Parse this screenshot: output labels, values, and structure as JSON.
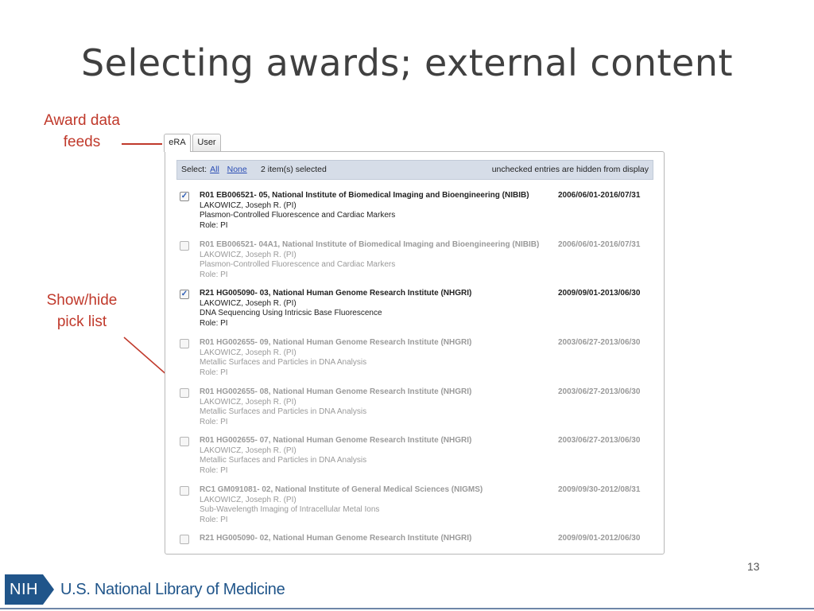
{
  "slide": {
    "title": "Selecting awards; external content",
    "page_number": "13"
  },
  "callouts": [
    {
      "line1": "Award data",
      "line2": "feeds"
    },
    {
      "line1": "Show/hide",
      "line2": "pick list"
    }
  ],
  "tabs": [
    {
      "label": "eRA",
      "active": true
    },
    {
      "label": "User",
      "active": false
    }
  ],
  "toolbar": {
    "select_label": "Select:",
    "all_link": "All",
    "none_link": "None",
    "count_text": "2 item(s) selected",
    "hidden_note": "unchecked entries are hidden from display"
  },
  "entries": [
    {
      "checked": true,
      "title": "R01 EB006521- 05, National Institute of Biomedical Imaging and Bioengineering (NIBIB)",
      "dates": "2006/06/01-2016/07/31",
      "person": "LAKOWICZ, Joseph R. (PI)",
      "project": "Plasmon-Controlled Fluorescence and Cardiac Markers",
      "role": "Role: PI"
    },
    {
      "checked": false,
      "title": "R01 EB006521- 04A1, National Institute of Biomedical Imaging and Bioengineering (NIBIB)",
      "dates": "2006/06/01-2016/07/31",
      "person": "LAKOWICZ, Joseph R. (PI)",
      "project": "Plasmon-Controlled Fluorescence and Cardiac Markers",
      "role": "Role: PI"
    },
    {
      "checked": true,
      "title": "R21 HG005090- 03, National Human Genome Research Institute (NHGRI)",
      "dates": "2009/09/01-2013/06/30",
      "person": "LAKOWICZ, Joseph R. (PI)",
      "project": "DNA Sequencing Using Intricsic Base Fluorescence",
      "role": "Role: PI"
    },
    {
      "checked": false,
      "title": "R01 HG002655- 09, National Human Genome Research Institute (NHGRI)",
      "dates": "2003/06/27-2013/06/30",
      "person": "LAKOWICZ, Joseph R. (PI)",
      "project": "Metallic Surfaces and Particles in DNA Analysis",
      "role": "Role: PI"
    },
    {
      "checked": false,
      "title": "R01 HG002655- 08, National Human Genome Research Institute (NHGRI)",
      "dates": "2003/06/27-2013/06/30",
      "person": "LAKOWICZ, Joseph R. (PI)",
      "project": "Metallic Surfaces and Particles in DNA Analysis",
      "role": "Role: PI"
    },
    {
      "checked": false,
      "title": "R01 HG002655- 07, National Human Genome Research Institute (NHGRI)",
      "dates": "2003/06/27-2013/06/30",
      "person": "LAKOWICZ, Joseph R. (PI)",
      "project": "Metallic Surfaces and Particles in DNA Analysis",
      "role": "Role: PI"
    },
    {
      "checked": false,
      "title": "RC1 GM091081- 02, National Institute of General Medical Sciences (NIGMS)",
      "dates": "2009/09/30-2012/08/31",
      "person": "LAKOWICZ, Joseph R. (PI)",
      "project": "Sub-Wavelength Imaging of Intracellular Metal Ions",
      "role": "Role: PI"
    },
    {
      "checked": false,
      "title": "R21 HG005090- 02, National Human Genome Research Institute (NHGRI)",
      "dates": "2009/09/01-2012/06/30",
      "person": "",
      "project": "",
      "role": ""
    }
  ],
  "footer": {
    "nih_label": "NIH",
    "library_name": "U.S. National Library of Medicine",
    "brand_color": "#20558a"
  },
  "colors": {
    "callout": "#c0392b",
    "toolbar_bg": "#d6dde8",
    "checkbox_check": "#2a5bb5",
    "unchecked_text": "#9a9a9a"
  }
}
